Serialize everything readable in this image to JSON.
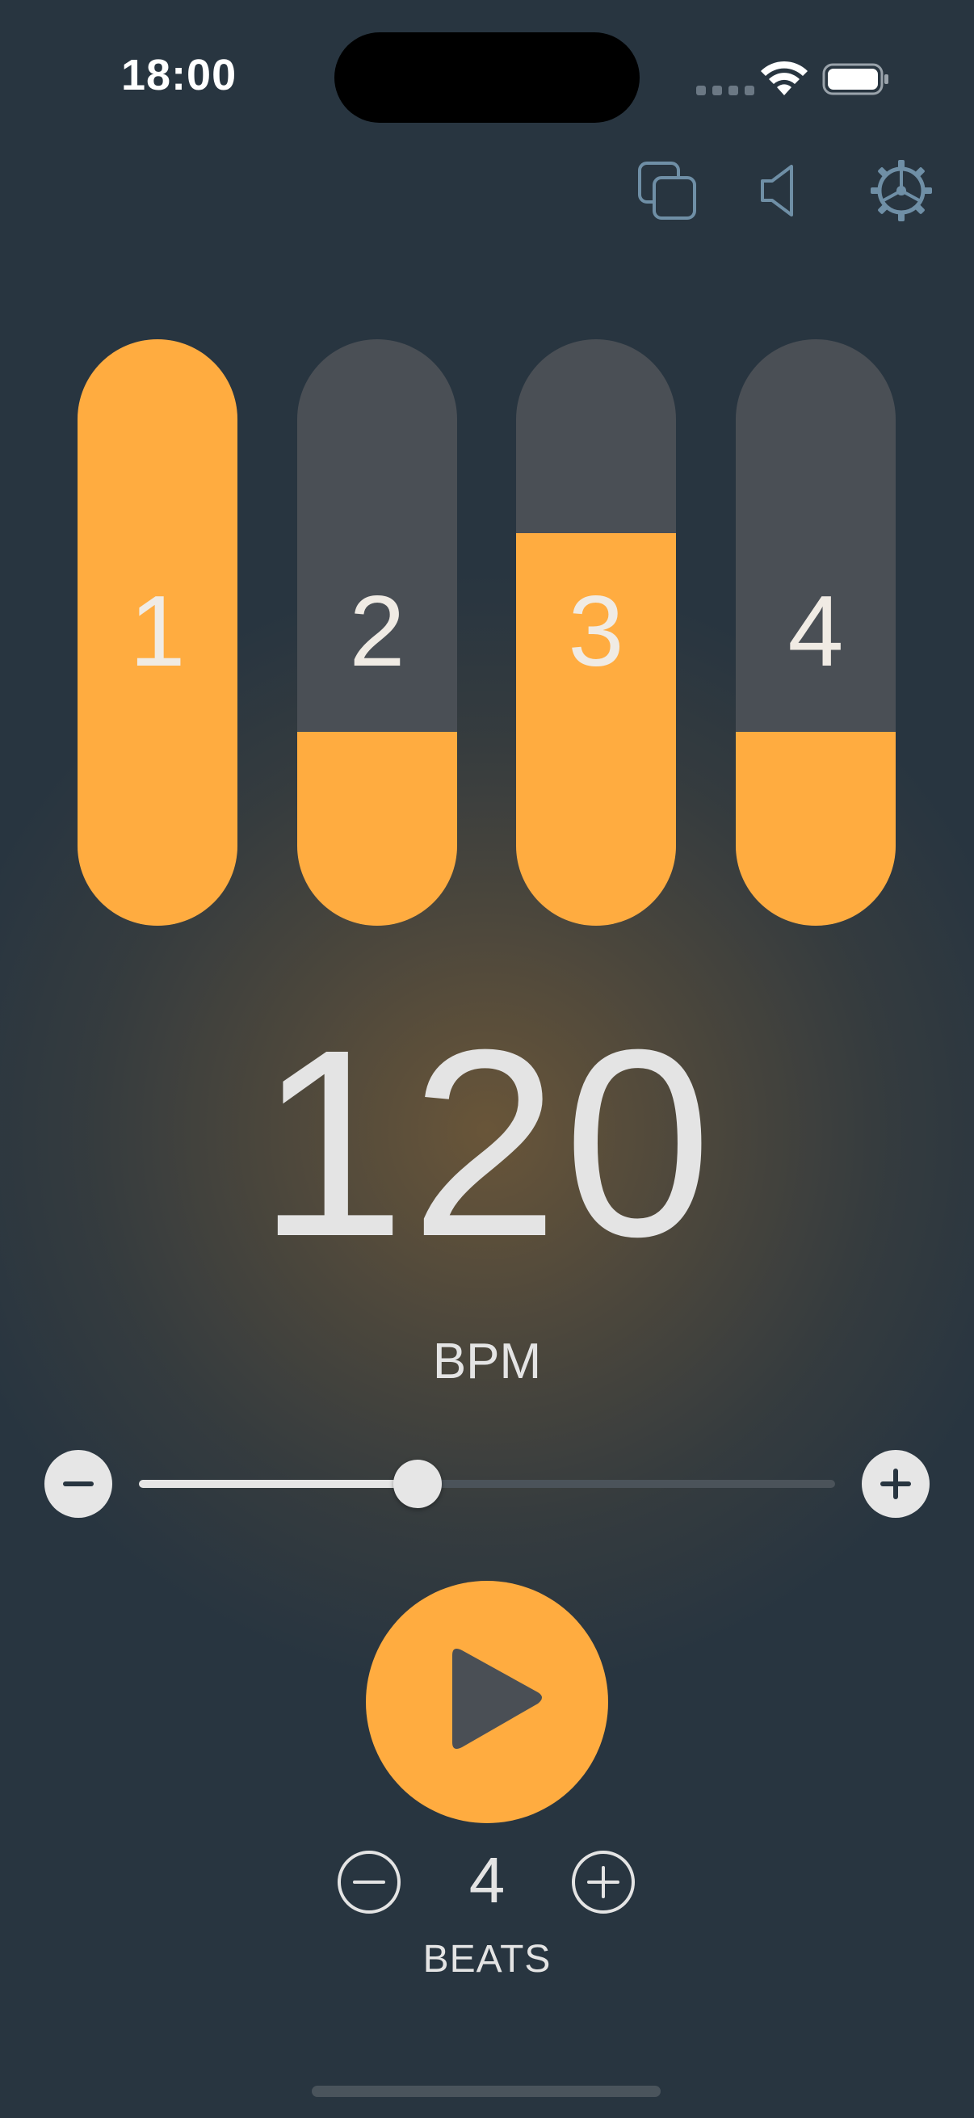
{
  "status_bar": {
    "time": "18:00"
  },
  "toolbar": {
    "icons": [
      "copy-icon",
      "speaker-icon",
      "settings-gear-icon"
    ],
    "icon_color": "#6f8fa6"
  },
  "beats": [
    {
      "label": "1",
      "level": 1.0
    },
    {
      "label": "2",
      "level": 0.33
    },
    {
      "label": "3",
      "level": 0.67
    },
    {
      "label": "4",
      "level": 0.33
    }
  ],
  "tempo": {
    "value": "120",
    "unit": "BPM",
    "slider_level": 0.5
  },
  "playback": {
    "state": "stopped",
    "icon": "play-icon"
  },
  "beats_per_bar": {
    "value": "4",
    "label": "BEATS"
  },
  "colors": {
    "accent": "#ffac40",
    "background": "#283540",
    "inactive": "#4a4f55",
    "text": "#e4e4e4"
  }
}
